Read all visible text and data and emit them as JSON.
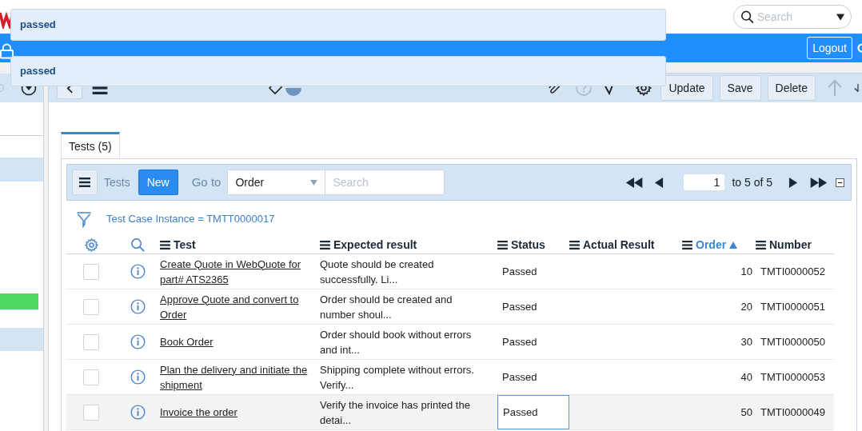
{
  "top_bar": {
    "search": {
      "placeholder": "Search"
    }
  },
  "nav_bar": {
    "logout": "Logout"
  },
  "suggestions": [
    {
      "label": "passed"
    },
    {
      "label": "passed"
    }
  ],
  "record_header": {
    "buttons": [
      "Update",
      "Save",
      "Delete"
    ]
  },
  "tabs": [
    {
      "label": "Tests (5)",
      "selected": true
    }
  ],
  "grid_toolbar": {
    "title": "Tests",
    "new": "New",
    "goto_label": "Go to",
    "goto_value": "Order",
    "search_placeholder": "Search",
    "page": "1",
    "range": "to 5 of 5"
  },
  "filter": "Test Case Instance = TMTT0000017",
  "columns": [
    {
      "label": "Test",
      "sorted": false
    },
    {
      "label": "Expected result",
      "sorted": false
    },
    {
      "label": "Status",
      "sorted": false
    },
    {
      "label": "Actual Result",
      "sorted": false
    },
    {
      "label": "Order",
      "sorted": true
    },
    {
      "label": "Number",
      "sorted": false
    }
  ],
  "rows": [
    {
      "test": "Create Quote in WebQuote for part# ATS2365",
      "expected": "Quote should be created successfully. Li...",
      "status": "Passed",
      "order": "10",
      "number": "TMTI0000052",
      "checked": false,
      "selected": false,
      "cell_focused": false
    },
    {
      "test": "Approve Quote and convert to Order",
      "expected": "Order should be created and number shoul...",
      "status": "Passed",
      "order": "20",
      "number": "TMTI0000051",
      "checked": false,
      "selected": false,
      "cell_focused": false
    },
    {
      "test": "Book Order",
      "expected": "Order should book without errors and int...",
      "status": "Passed",
      "order": "30",
      "number": "TMTI0000050",
      "checked": false,
      "selected": false,
      "cell_focused": false
    },
    {
      "test": "Plan the delivery and initiate the shipment",
      "expected": "Shipping complete without errors. Verify...",
      "status": "Passed",
      "order": "40",
      "number": "TMTI0000053",
      "checked": false,
      "selected": false,
      "cell_focused": false
    },
    {
      "test": "Invoice the order",
      "expected": "Verify the invoice has printed the detai...",
      "status": "Passed",
      "order": "50",
      "number": "TMTI0000049",
      "checked": false,
      "selected": true,
      "cell_focused": true
    }
  ]
}
